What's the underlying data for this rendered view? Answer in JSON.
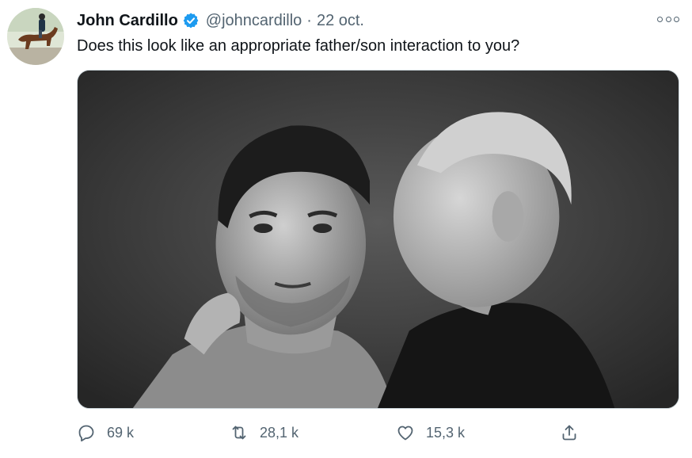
{
  "tweet": {
    "author_name": "John Cardillo",
    "handle": "@johncardillo",
    "separator": "·",
    "date": "22 oct.",
    "text": "Does this look like an appropriate father/son interaction to you?",
    "verified": true
  },
  "icons": {
    "avatar": "horse-rider-avatar",
    "verified": "verified-badge-icon",
    "more": "more-options-icon",
    "reply": "reply-icon",
    "retweet": "retweet-icon",
    "like": "heart-icon",
    "share": "share-icon"
  },
  "stats": {
    "replies": "69 k",
    "retweets": "28,1 k",
    "likes": "15,3 k"
  },
  "colors": {
    "verified_blue": "#1d9bf0",
    "text_primary": "#0f1419",
    "text_secondary": "#536471",
    "border": "#cfd9de"
  }
}
